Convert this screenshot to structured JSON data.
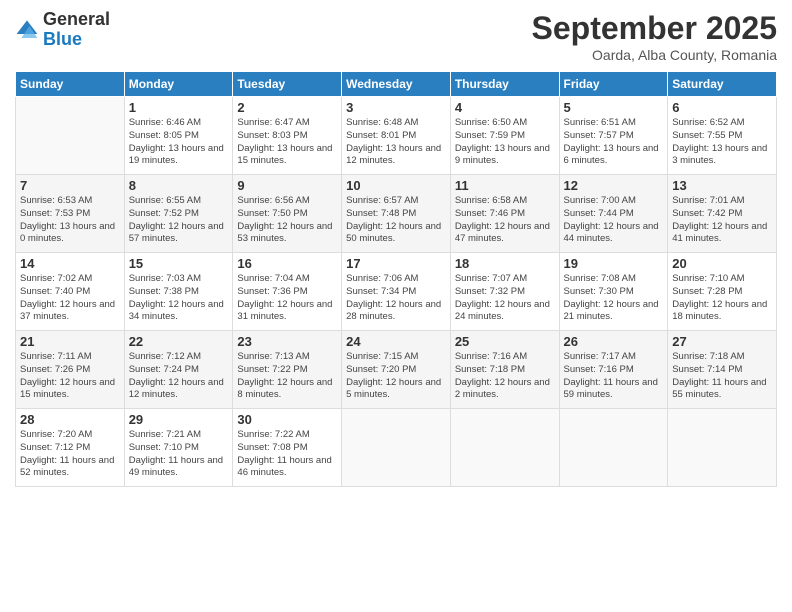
{
  "header": {
    "logo_general": "General",
    "logo_blue": "Blue",
    "month_title": "September 2025",
    "subtitle": "Oarda, Alba County, Romania"
  },
  "days_of_week": [
    "Sunday",
    "Monday",
    "Tuesday",
    "Wednesday",
    "Thursday",
    "Friday",
    "Saturday"
  ],
  "weeks": [
    [
      {
        "day": "",
        "empty": true
      },
      {
        "day": "1",
        "sunrise": "Sunrise: 6:46 AM",
        "sunset": "Sunset: 8:05 PM",
        "daylight": "Daylight: 13 hours and 19 minutes."
      },
      {
        "day": "2",
        "sunrise": "Sunrise: 6:47 AM",
        "sunset": "Sunset: 8:03 PM",
        "daylight": "Daylight: 13 hours and 15 minutes."
      },
      {
        "day": "3",
        "sunrise": "Sunrise: 6:48 AM",
        "sunset": "Sunset: 8:01 PM",
        "daylight": "Daylight: 13 hours and 12 minutes."
      },
      {
        "day": "4",
        "sunrise": "Sunrise: 6:50 AM",
        "sunset": "Sunset: 7:59 PM",
        "daylight": "Daylight: 13 hours and 9 minutes."
      },
      {
        "day": "5",
        "sunrise": "Sunrise: 6:51 AM",
        "sunset": "Sunset: 7:57 PM",
        "daylight": "Daylight: 13 hours and 6 minutes."
      },
      {
        "day": "6",
        "sunrise": "Sunrise: 6:52 AM",
        "sunset": "Sunset: 7:55 PM",
        "daylight": "Daylight: 13 hours and 3 minutes."
      }
    ],
    [
      {
        "day": "7",
        "sunrise": "Sunrise: 6:53 AM",
        "sunset": "Sunset: 7:53 PM",
        "daylight": "Daylight: 13 hours and 0 minutes."
      },
      {
        "day": "8",
        "sunrise": "Sunrise: 6:55 AM",
        "sunset": "Sunset: 7:52 PM",
        "daylight": "Daylight: 12 hours and 57 minutes."
      },
      {
        "day": "9",
        "sunrise": "Sunrise: 6:56 AM",
        "sunset": "Sunset: 7:50 PM",
        "daylight": "Daylight: 12 hours and 53 minutes."
      },
      {
        "day": "10",
        "sunrise": "Sunrise: 6:57 AM",
        "sunset": "Sunset: 7:48 PM",
        "daylight": "Daylight: 12 hours and 50 minutes."
      },
      {
        "day": "11",
        "sunrise": "Sunrise: 6:58 AM",
        "sunset": "Sunset: 7:46 PM",
        "daylight": "Daylight: 12 hours and 47 minutes."
      },
      {
        "day": "12",
        "sunrise": "Sunrise: 7:00 AM",
        "sunset": "Sunset: 7:44 PM",
        "daylight": "Daylight: 12 hours and 44 minutes."
      },
      {
        "day": "13",
        "sunrise": "Sunrise: 7:01 AM",
        "sunset": "Sunset: 7:42 PM",
        "daylight": "Daylight: 12 hours and 41 minutes."
      }
    ],
    [
      {
        "day": "14",
        "sunrise": "Sunrise: 7:02 AM",
        "sunset": "Sunset: 7:40 PM",
        "daylight": "Daylight: 12 hours and 37 minutes."
      },
      {
        "day": "15",
        "sunrise": "Sunrise: 7:03 AM",
        "sunset": "Sunset: 7:38 PM",
        "daylight": "Daylight: 12 hours and 34 minutes."
      },
      {
        "day": "16",
        "sunrise": "Sunrise: 7:04 AM",
        "sunset": "Sunset: 7:36 PM",
        "daylight": "Daylight: 12 hours and 31 minutes."
      },
      {
        "day": "17",
        "sunrise": "Sunrise: 7:06 AM",
        "sunset": "Sunset: 7:34 PM",
        "daylight": "Daylight: 12 hours and 28 minutes."
      },
      {
        "day": "18",
        "sunrise": "Sunrise: 7:07 AM",
        "sunset": "Sunset: 7:32 PM",
        "daylight": "Daylight: 12 hours and 24 minutes."
      },
      {
        "day": "19",
        "sunrise": "Sunrise: 7:08 AM",
        "sunset": "Sunset: 7:30 PM",
        "daylight": "Daylight: 12 hours and 21 minutes."
      },
      {
        "day": "20",
        "sunrise": "Sunrise: 7:10 AM",
        "sunset": "Sunset: 7:28 PM",
        "daylight": "Daylight: 12 hours and 18 minutes."
      }
    ],
    [
      {
        "day": "21",
        "sunrise": "Sunrise: 7:11 AM",
        "sunset": "Sunset: 7:26 PM",
        "daylight": "Daylight: 12 hours and 15 minutes."
      },
      {
        "day": "22",
        "sunrise": "Sunrise: 7:12 AM",
        "sunset": "Sunset: 7:24 PM",
        "daylight": "Daylight: 12 hours and 12 minutes."
      },
      {
        "day": "23",
        "sunrise": "Sunrise: 7:13 AM",
        "sunset": "Sunset: 7:22 PM",
        "daylight": "Daylight: 12 hours and 8 minutes."
      },
      {
        "day": "24",
        "sunrise": "Sunrise: 7:15 AM",
        "sunset": "Sunset: 7:20 PM",
        "daylight": "Daylight: 12 hours and 5 minutes."
      },
      {
        "day": "25",
        "sunrise": "Sunrise: 7:16 AM",
        "sunset": "Sunset: 7:18 PM",
        "daylight": "Daylight: 12 hours and 2 minutes."
      },
      {
        "day": "26",
        "sunrise": "Sunrise: 7:17 AM",
        "sunset": "Sunset: 7:16 PM",
        "daylight": "Daylight: 11 hours and 59 minutes."
      },
      {
        "day": "27",
        "sunrise": "Sunrise: 7:18 AM",
        "sunset": "Sunset: 7:14 PM",
        "daylight": "Daylight: 11 hours and 55 minutes."
      }
    ],
    [
      {
        "day": "28",
        "sunrise": "Sunrise: 7:20 AM",
        "sunset": "Sunset: 7:12 PM",
        "daylight": "Daylight: 11 hours and 52 minutes."
      },
      {
        "day": "29",
        "sunrise": "Sunrise: 7:21 AM",
        "sunset": "Sunset: 7:10 PM",
        "daylight": "Daylight: 11 hours and 49 minutes."
      },
      {
        "day": "30",
        "sunrise": "Sunrise: 7:22 AM",
        "sunset": "Sunset: 7:08 PM",
        "daylight": "Daylight: 11 hours and 46 minutes."
      },
      {
        "day": "",
        "empty": true
      },
      {
        "day": "",
        "empty": true
      },
      {
        "day": "",
        "empty": true
      },
      {
        "day": "",
        "empty": true
      }
    ]
  ]
}
